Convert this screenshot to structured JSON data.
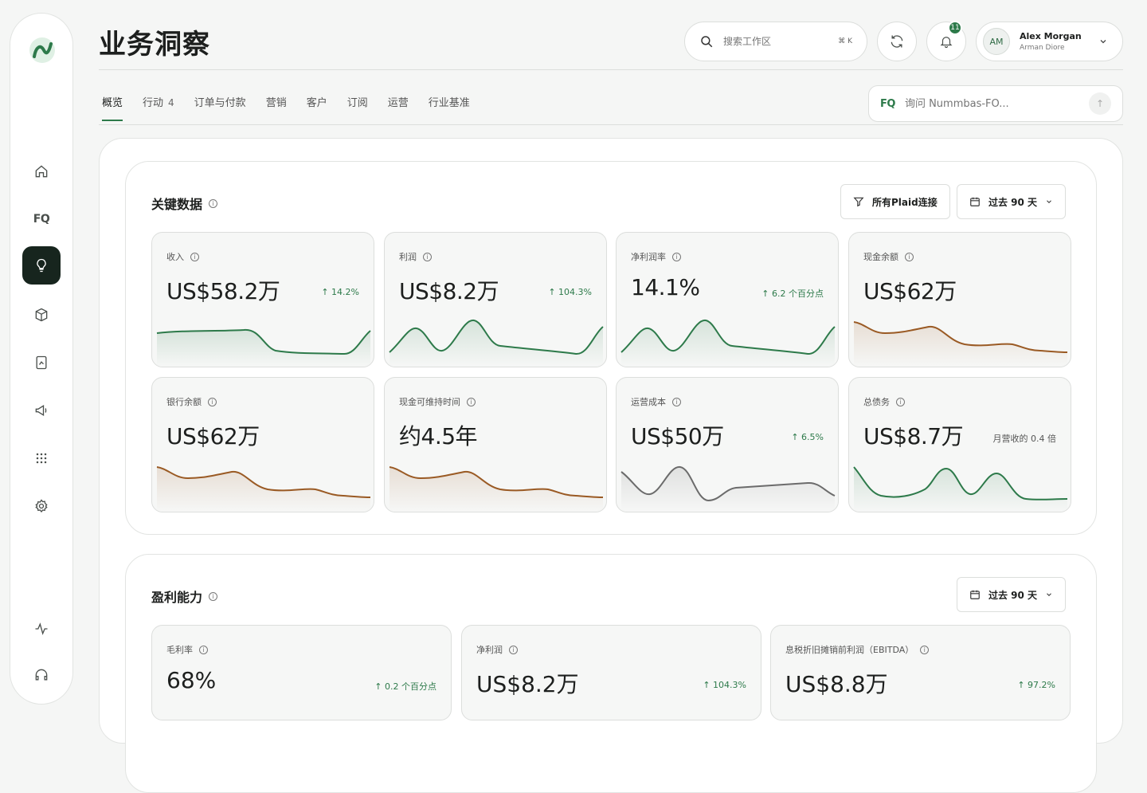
{
  "header": {
    "title": "业务洞察"
  },
  "search": {
    "placeholder": "搜索工作区",
    "shortcut": "⌘ K"
  },
  "notifications": {
    "count": "11"
  },
  "user": {
    "initials": "AM",
    "name": "Alex Morgan",
    "subtitle": "Arman Diore"
  },
  "tabs": [
    {
      "label": "概览",
      "active": true
    },
    {
      "label": "行动",
      "count": "4"
    },
    {
      "label": "订单与付款"
    },
    {
      "label": "营销"
    },
    {
      "label": "客户"
    },
    {
      "label": "订阅"
    },
    {
      "label": "运营"
    },
    {
      "label": "行业基准"
    }
  ],
  "ask": {
    "badge": "FQ",
    "placeholder": "询问 Nummbas-FO..."
  },
  "sidebar": {
    "fq_label": "FQ"
  },
  "key_metrics": {
    "title": "关键数据",
    "filter_label": "所有Plaid连接",
    "range_label": "过去 90 天",
    "cards": [
      {
        "label": "收入",
        "value": "US$58.2万",
        "delta": "↑ 14.2%",
        "trend": "green-a"
      },
      {
        "label": "利润",
        "value": "US$8.2万",
        "delta": "↑ 104.3%",
        "trend": "green-b"
      },
      {
        "label": "净利润率",
        "value": "14.1%",
        "delta": "↑ 6.2 个百分点",
        "trend": "green-b"
      },
      {
        "label": "现金余额",
        "value": "US$62万",
        "delta": "",
        "trend": "brown"
      },
      {
        "label": "银行余额",
        "value": "US$62万",
        "delta": "",
        "trend": "brown"
      },
      {
        "label": "现金可维持时间",
        "value": "约4.5年",
        "delta": "",
        "trend": "brown"
      },
      {
        "label": "运营成本",
        "value": "US$50万",
        "delta": "↑ 6.5%",
        "trend": "gray"
      },
      {
        "label": "总债务",
        "value": "US$8.7万",
        "note": "月营收的 0.4 倍",
        "trend": "green-c"
      }
    ]
  },
  "profitability": {
    "title": "盈利能力",
    "range_label": "过去 90 天",
    "cards": [
      {
        "label": "毛利率",
        "value": "68%",
        "delta": "↑ 0.2 个百分点"
      },
      {
        "label": "净利润",
        "value": "US$8.2万",
        "delta": "↑ 104.3%"
      },
      {
        "label": "息税折旧摊销前利润（EBITDA）",
        "value": "US$8.8万",
        "delta": "↑ 97.2%"
      }
    ]
  },
  "colors": {
    "accent": "#2d7a4a",
    "brown": "#9a5a24",
    "gray": "#6b6b6b",
    "active_nav": "#17251e"
  }
}
